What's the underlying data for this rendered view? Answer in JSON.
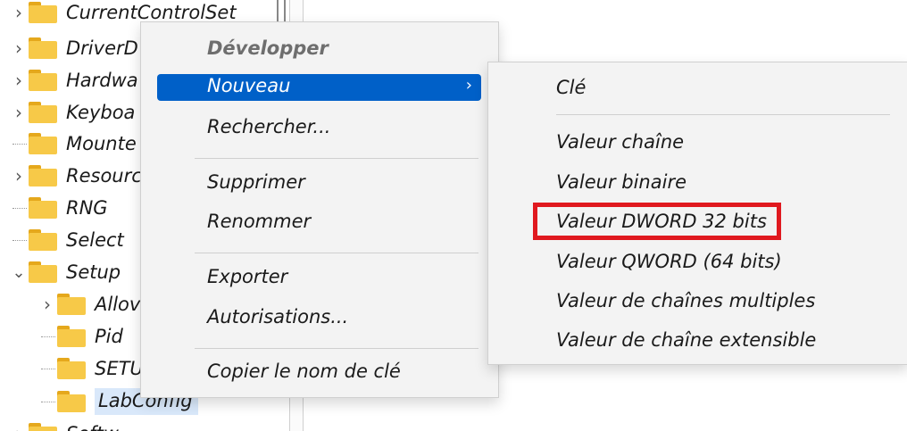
{
  "tree": {
    "items": [
      {
        "label": "CurrentControlSet",
        "expander": "chevron-right"
      },
      {
        "label": "DriverD",
        "expander": "chevron-right"
      },
      {
        "label": "Hardwa",
        "expander": "chevron-right"
      },
      {
        "label": "Keyboa",
        "expander": "chevron-right"
      },
      {
        "label": "Mounte",
        "expander": "none"
      },
      {
        "label": "Resourc",
        "expander": "chevron-right"
      },
      {
        "label": "RNG",
        "expander": "none"
      },
      {
        "label": "Select",
        "expander": "none"
      },
      {
        "label": "Setup",
        "expander": "chevron-down"
      },
      {
        "label": "Allov",
        "expander": "chevron-right"
      },
      {
        "label": "Pid",
        "expander": "none"
      },
      {
        "label": "SETU",
        "expander": "none"
      },
      {
        "label": "LabConfig",
        "expander": "none",
        "selected": true
      },
      {
        "label": "Softw",
        "expander": "chevron-right"
      }
    ]
  },
  "context_menu": {
    "expand": "Développer",
    "new": "Nouveau",
    "find": "Rechercher...",
    "delete": "Supprimer",
    "rename": "Renommer",
    "export": "Exporter",
    "permissions": "Autorisations...",
    "copy_key_name": "Copier le nom de clé",
    "submenu_arrow": "›"
  },
  "submenu": {
    "key": "Clé",
    "string_value": "Valeur chaîne",
    "binary_value": "Valeur binaire",
    "dword_value": "Valeur DWORD 32 bits",
    "qword_value": "Valeur QWORD (64 bits)",
    "multi_string_value": "Valeur de chaînes multiples",
    "expandable_string_value": "Valeur de chaîne extensible"
  },
  "icons": {
    "folder": "folder-icon",
    "chevron_right": "chevron-right-icon",
    "chevron_down": "chevron-down-icon"
  },
  "colors": {
    "menu_highlight": "#0060c8",
    "annotation_box": "#e0191f",
    "folder": "#f7c948",
    "selection": "#d9e8fa"
  }
}
